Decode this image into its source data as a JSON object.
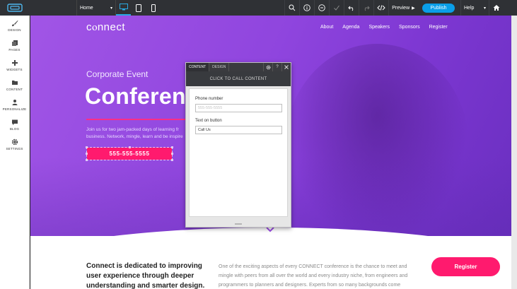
{
  "toolbar": {
    "page_select": "Home",
    "preview_label": "Preview",
    "publish_label": "Publish",
    "help_label": "Help",
    "accent_color": "#0a9ee8"
  },
  "sidebar": {
    "items": [
      {
        "label": "DESIGN",
        "icon": "brush-icon"
      },
      {
        "label": "PAGES",
        "icon": "pages-icon"
      },
      {
        "label": "WIDGETS",
        "icon": "plus-icon"
      },
      {
        "label": "CONTENT",
        "icon": "folder-icon"
      },
      {
        "label": "PERSONALIZE",
        "icon": "user-icon"
      },
      {
        "label": "BLOG",
        "icon": "chat-icon"
      },
      {
        "label": "SETTINGS",
        "icon": "gear-icon"
      }
    ]
  },
  "site": {
    "brand": "cⲟnnect",
    "nav": [
      "About",
      "Agenda",
      "Speakers",
      "Sponsors",
      "Register"
    ],
    "hero_subtitle": "Corporate Event",
    "hero_title": "Conferen",
    "hero_desc": "Join us for two jam-packed days of learning fr business. Network, mingle, learn and be inspire",
    "phone_button": "555-555-5555",
    "about_title": "Connect is dedicated to  improving user experience through deeper understanding and smarter design.",
    "about_text": "One of the exciting aspects of every CONNECT conference is the chance to meet and mingle with peers from all over the world and every industry niche, from engineers and programmers to planners and designers. Experts from so many backgrounds come",
    "register_label": "Register",
    "brand_pink": "#ff1a6e"
  },
  "panel": {
    "tabs": [
      "CONTENT",
      "DESIGN"
    ],
    "title": "CLICK TO CALL CONTENT",
    "phone_label": "Phone number",
    "phone_placeholder": "555-555-5555",
    "button_text_label": "Text on button",
    "button_text_value": "Call Us"
  }
}
